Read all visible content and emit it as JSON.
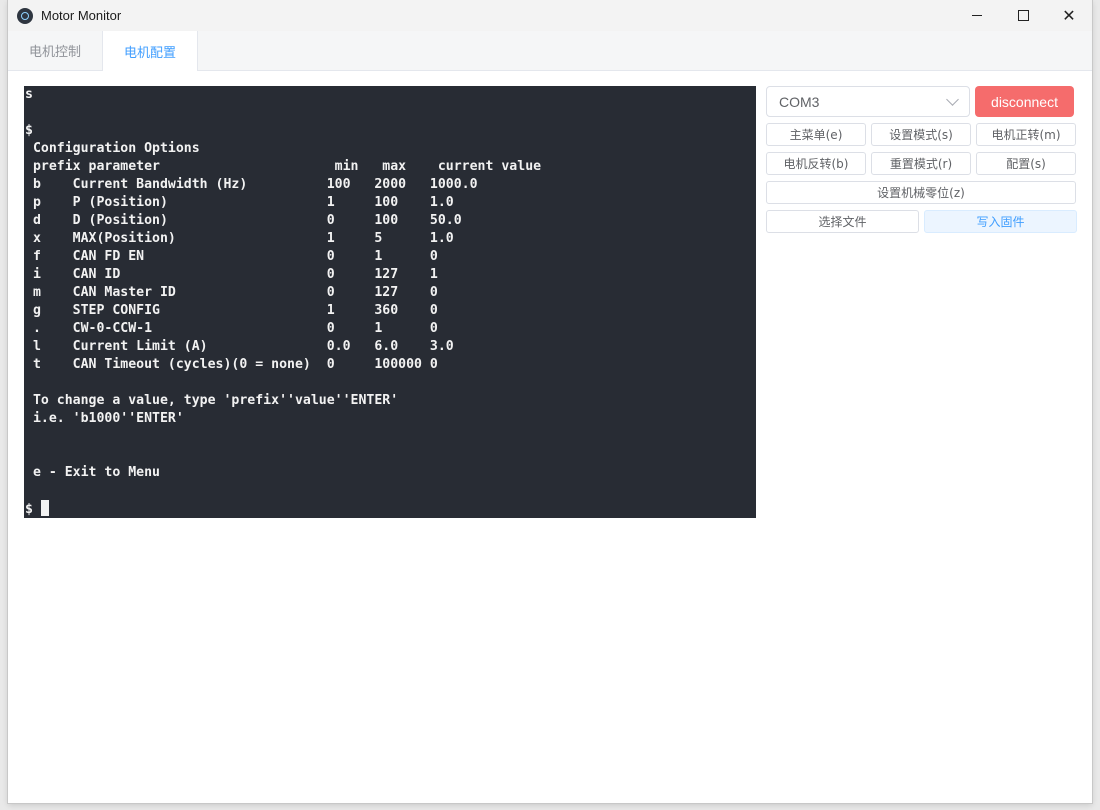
{
  "window": {
    "title": "Motor Monitor"
  },
  "tabs": [
    {
      "label": "电机控制",
      "active": false
    },
    {
      "label": "电机配置",
      "active": true
    }
  ],
  "terminal": {
    "lines": [
      "s",
      "",
      "$",
      " Configuration Options",
      " prefix parameter                      min   max    current value",
      " b    Current Bandwidth (Hz)          100   2000   1000.0",
      " p    P (Position)                    1     100    1.0",
      " d    D (Position)                    0     100    50.0",
      " x    MAX(Position)                   1     5      1.0",
      " f    CAN FD EN                       0     1      0",
      " i    CAN ID                          0     127    1",
      " m    CAN Master ID                   0     127    0",
      " g    STEP CONFIG                     1     360    0",
      " .    CW-0-CCW-1                      0     1      0",
      " l    Current Limit (A)               0.0   6.0    3.0",
      " t    CAN Timeout (cycles)(0 = none)  0     100000 0",
      "",
      " To change a value, type 'prefix''value''ENTER'",
      " i.e. 'b1000''ENTER'",
      "",
      "",
      " e - Exit to Menu",
      ""
    ],
    "prompt": "$"
  },
  "controls": {
    "port_select": {
      "value": "COM3"
    },
    "disconnect_label": "disconnect",
    "main_menu_label": "主菜单(e)",
    "setup_mode_label": "设置模式(s)",
    "motor_forward_label": "电机正转(m)",
    "motor_reverse_label": "电机反转(b)",
    "reset_mode_label": "重置模式(r)",
    "config_label": "配置(s)",
    "set_zero_label": "设置机械零位(z)",
    "choose_file_label": "选择文件",
    "write_firmware_label": "写入固件"
  },
  "colors": {
    "terminal_bg": "#282c34",
    "accent": "#409eff",
    "danger": "#f56c6c"
  }
}
